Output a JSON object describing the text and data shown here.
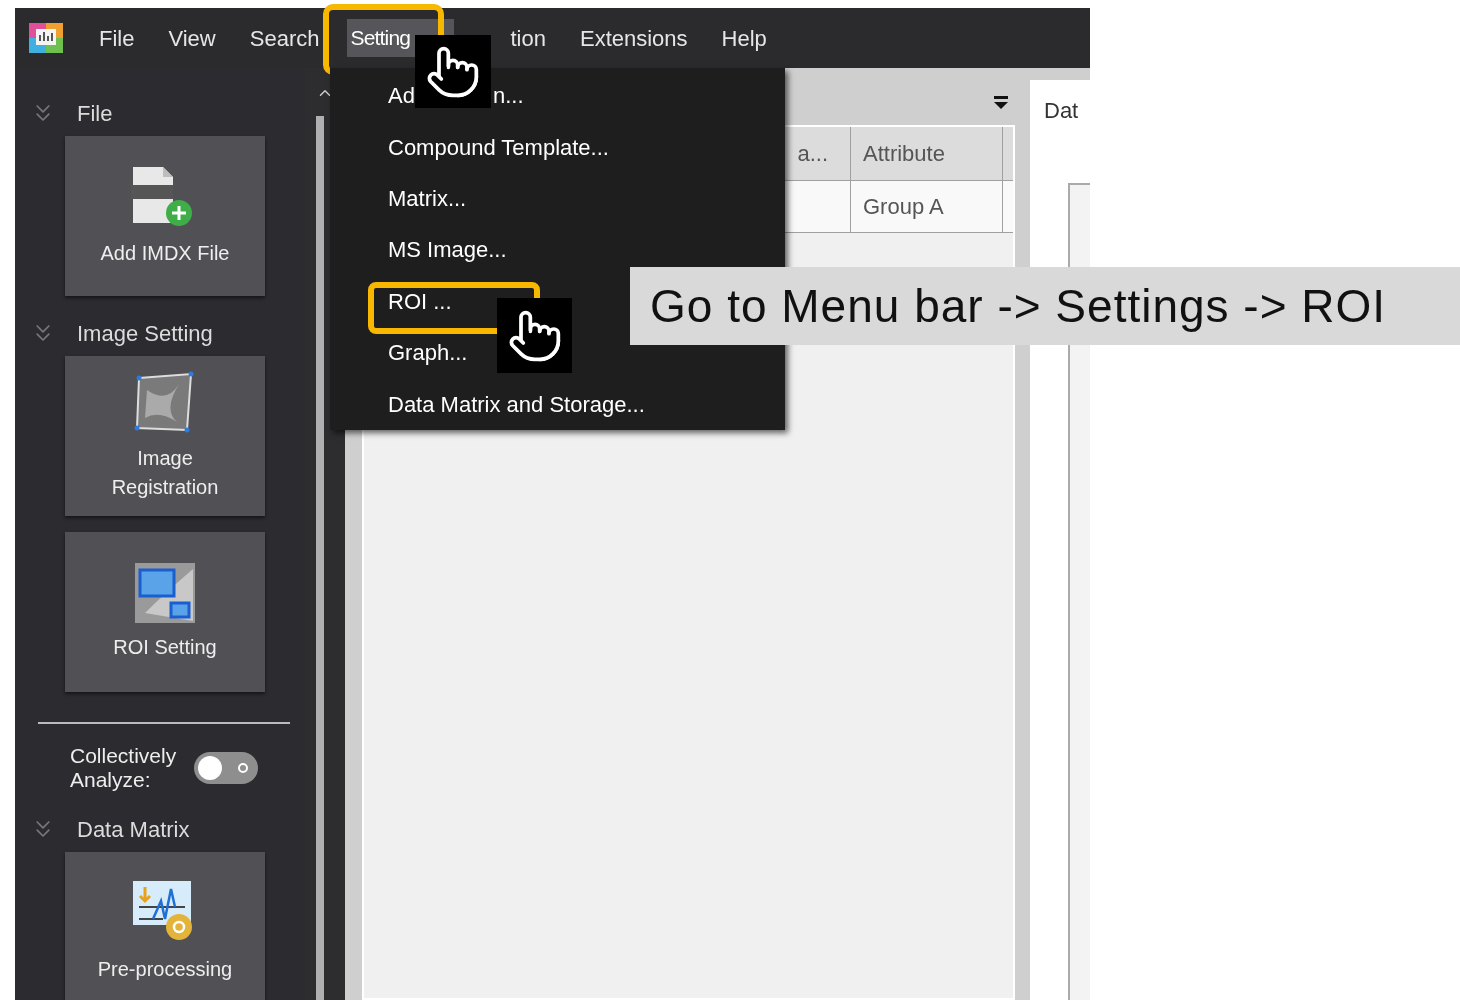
{
  "menu_bar": {
    "items": [
      {
        "label": "File",
        "selected": false
      },
      {
        "label": "View",
        "selected": false
      },
      {
        "label": "Search",
        "selected": false
      },
      {
        "label": "Setting",
        "selected": true
      },
      {
        "label": "tion",
        "selected": false
      },
      {
        "label": "Extensions",
        "selected": false
      },
      {
        "label": "Help",
        "selected": false
      }
    ]
  },
  "dropdown": {
    "items": [
      {
        "kind": "obscured",
        "label_start": "Ad",
        "label_end": "n...",
        "highlighted": false
      },
      {
        "kind": "plain",
        "label": "Compound Template...",
        "highlighted": false
      },
      {
        "kind": "plain",
        "label": "Matrix...",
        "highlighted": false
      },
      {
        "kind": "plain",
        "label": "MS Image...",
        "highlighted": false
      },
      {
        "kind": "plain",
        "label": "ROI ...",
        "highlighted": true
      },
      {
        "kind": "plain",
        "label": "Graph...",
        "highlighted": false
      },
      {
        "kind": "plain",
        "label": "Data Matrix and Storage...",
        "highlighted": false
      }
    ]
  },
  "sidebar": {
    "sections": [
      {
        "title": "File",
        "tiles": [
          {
            "kind": "imdx",
            "label": "Add IMDX File"
          }
        ]
      },
      {
        "title": "Image Setting",
        "tiles": [
          {
            "kind": "registration",
            "label": "Image\nRegistration"
          },
          {
            "kind": "roi",
            "label": "ROI Setting"
          }
        ],
        "toggle": {
          "label": "Collectively\nAnalyze:",
          "on": false
        }
      },
      {
        "title": "Data Matrix",
        "tiles": [
          {
            "kind": "preprocess",
            "label": "Pre-processing"
          }
        ]
      }
    ]
  },
  "table": {
    "columns": [
      "a...",
      "Attribute"
    ],
    "rows": [
      [
        "",
        "Group A"
      ]
    ]
  },
  "right_panel": {
    "title": "Dat"
  },
  "annotation": {
    "text": "Go to Menu bar -> Settings -> ROI"
  }
}
